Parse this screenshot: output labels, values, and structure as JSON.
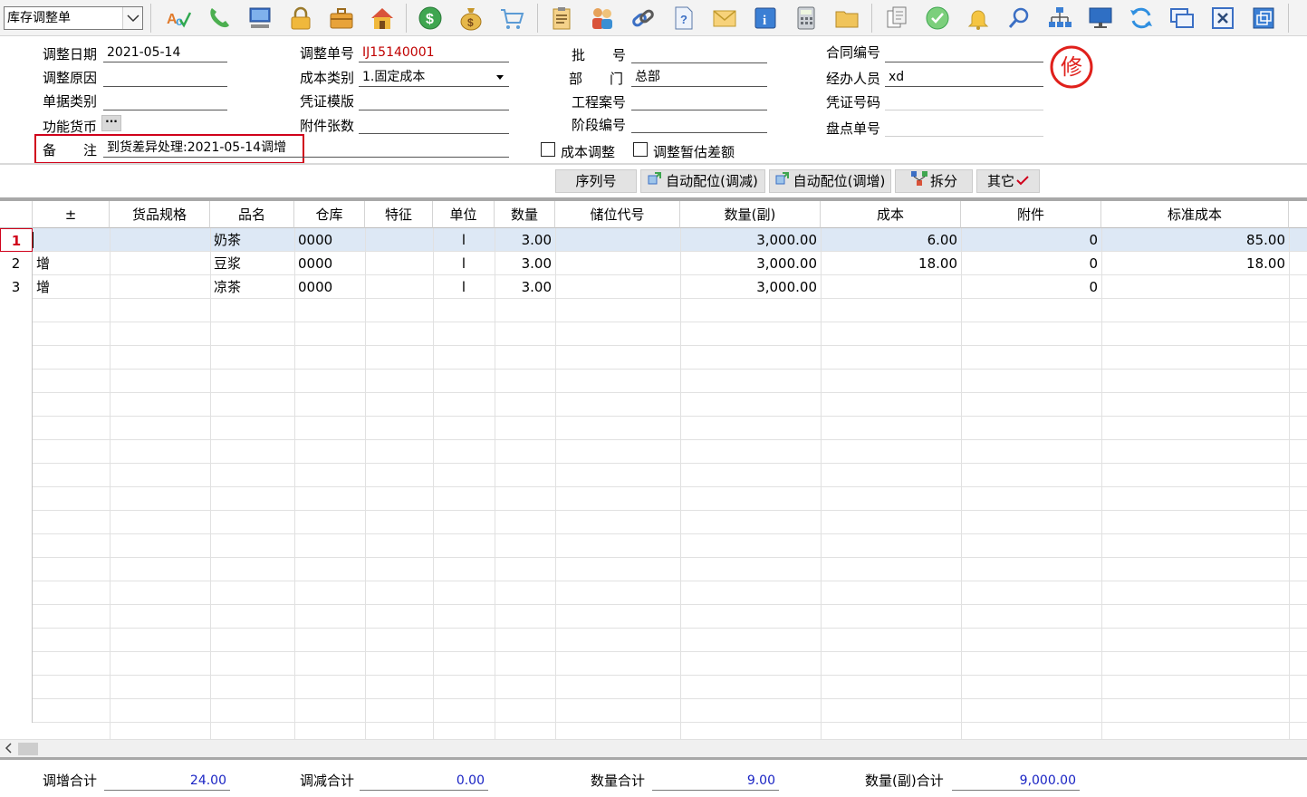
{
  "toolbar": {
    "doc_type": "库存调整单",
    "icons": [
      "spell-check-icon",
      "phone-icon",
      "computer-icon",
      "lock-icon",
      "briefcase-icon",
      "house-icon",
      "dollar-icon",
      "money-bag-icon",
      "cart-icon",
      "clipboard-icon",
      "users-icon",
      "link-icon",
      "help-doc-icon",
      "mail-icon",
      "info-icon",
      "calculator-icon",
      "folder-icon",
      "copy-doc-icon",
      "check-circle-icon",
      "bell-icon",
      "search-icon",
      "org-chart-icon",
      "monitor-icon",
      "refresh-icon",
      "windows-icon",
      "close-icon",
      "restore-icon"
    ]
  },
  "form": {
    "adjust_date_label": "调整日期",
    "adjust_date": "2021-05-14",
    "adjust_reason_label": "调整原因",
    "adjust_reason": "",
    "doc_category_label": "单据类别",
    "doc_category": "",
    "currency_label": "功能货币",
    "currency_btn": "···",
    "remark_label": "备　　注",
    "remark": "到货差异处理:2021-05-14调增",
    "doc_no_label": "调整单号",
    "doc_no": "IJ15140001",
    "cost_type_label": "成本类别",
    "cost_type": "1.固定成本",
    "voucher_tpl_label": "凭证模版",
    "voucher_tpl": "",
    "attach_count_label": "附件张数",
    "attach_count": "",
    "batch_label": "批　　号",
    "batch": "",
    "dept_label": "部　　门",
    "dept": "总部",
    "project_label": "工程案号",
    "project": "",
    "stage_label": "阶段编号",
    "stage": "",
    "contract_label": "合同编号",
    "contract": "",
    "handler_label": "经办人员",
    "handler": "xd",
    "voucher_no_label": "凭证号码",
    "voucher_no": "",
    "inventory_no_label": "盘点单号",
    "inventory_no": "",
    "cost_adjust_label": "成本调整",
    "estimate_diff_label": "调整暂估差额",
    "stamp_char": "修"
  },
  "actions": {
    "serial": "序列号",
    "auto_alloc_decrease": "自动配位(调减)",
    "auto_alloc_increase": "自动配位(调增)",
    "split": "拆分",
    "other": "其它"
  },
  "grid": {
    "columns": [
      "±",
      "货品规格",
      "品名",
      "仓库",
      "特征",
      "单位",
      "数量",
      "储位代号",
      "数量(副)",
      "成本",
      "附件",
      "标准成本"
    ],
    "rows": [
      {
        "num": "1",
        "pm": "",
        "spec": "",
        "name": "奶茶",
        "wh": "0000",
        "feature": "",
        "unit": "l",
        "qty": "3.00",
        "bin": "",
        "qty2": "3,000.00",
        "cost": "6.00",
        "attach": "0",
        "std_cost": "85.00"
      },
      {
        "num": "2",
        "pm": "增",
        "spec": "",
        "name": "豆浆",
        "wh": "0000",
        "feature": "",
        "unit": "l",
        "qty": "3.00",
        "bin": "",
        "qty2": "3,000.00",
        "cost": "18.00",
        "attach": "0",
        "std_cost": "18.00"
      },
      {
        "num": "3",
        "pm": "增",
        "spec": "",
        "name": "凉茶",
        "wh": "0000",
        "feature": "",
        "unit": "l",
        "qty": "3.00",
        "bin": "",
        "qty2": "3,000.00",
        "cost": "",
        "attach": "0",
        "std_cost": ""
      }
    ]
  },
  "footer": {
    "increase_total_label": "调增合计",
    "increase_total": "24.00",
    "decrease_total_label": "调减合计",
    "decrease_total": "0.00",
    "qty_total_label": "数量合计",
    "qty_total": "9.00",
    "qty2_total_label": "数量(副)合计",
    "qty2_total": "9,000.00"
  }
}
